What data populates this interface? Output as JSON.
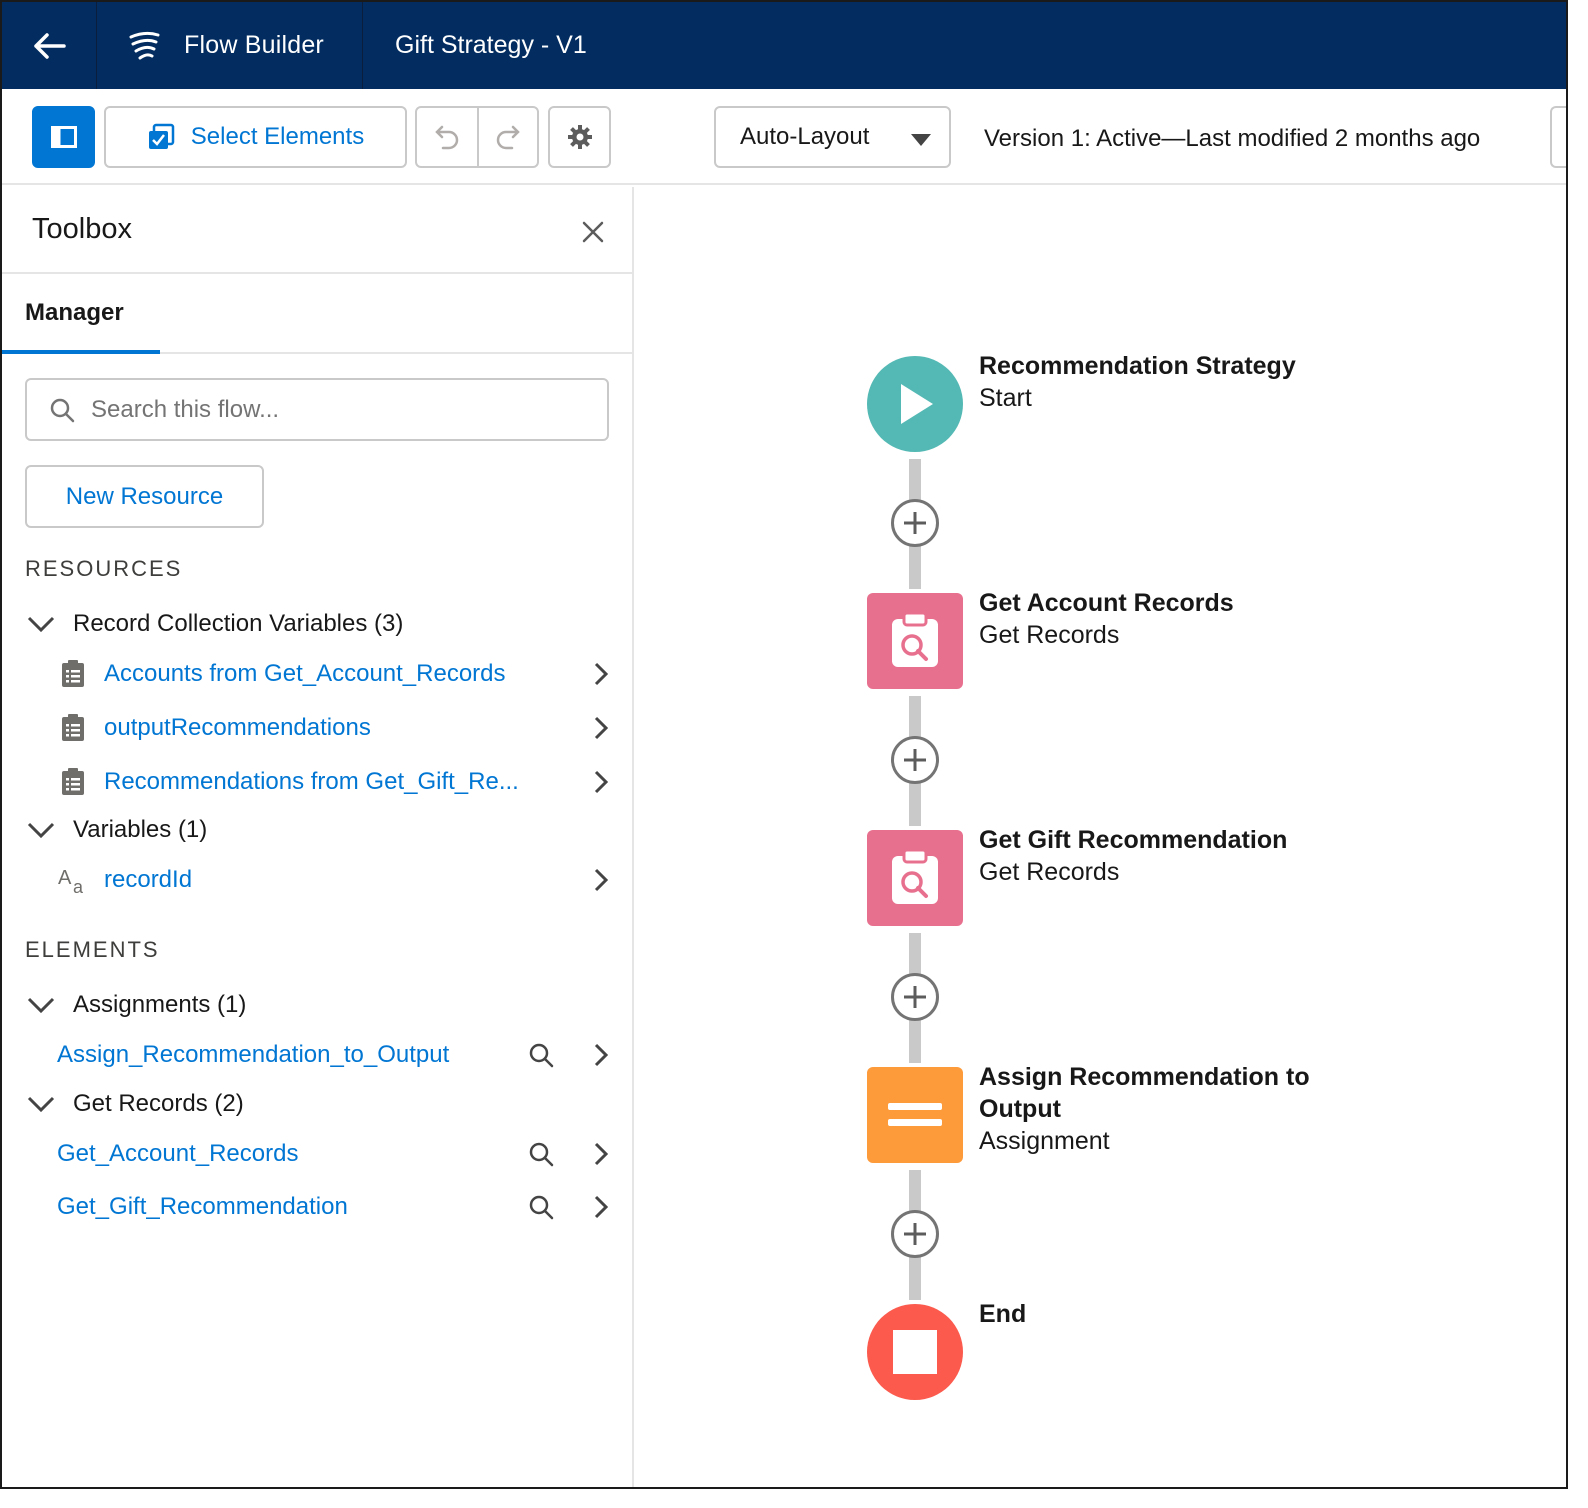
{
  "header": {
    "app_title": "Flow Builder",
    "flow_title": "Gift Strategy - V1"
  },
  "toolbar": {
    "select_elements_label": "Select Elements",
    "layout_value": "Auto-Layout",
    "version_status": "Version 1: Active—Last modified 2 months ago"
  },
  "toolbox": {
    "title": "Toolbox",
    "tab_manager": "Manager",
    "search_placeholder": "Search this flow...",
    "new_resource_label": "New Resource",
    "resources_heading": "RESOURCES",
    "elements_heading": "ELEMENTS",
    "resource_groups": [
      {
        "label": "Record Collection Variables (3)",
        "items": [
          "Accounts from Get_Account_Records",
          "outputRecommendations",
          "Recommendations from Get_Gift_Re..."
        ]
      },
      {
        "label": "Variables (1)",
        "items": [
          "recordId"
        ]
      }
    ],
    "element_groups": [
      {
        "label": "Assignments (1)",
        "items": [
          "Assign_Recommendation_to_Output"
        ]
      },
      {
        "label": "Get Records (2)",
        "items": [
          "Get_Account_Records",
          "Get_Gift_Recommendation"
        ]
      }
    ]
  },
  "canvas": {
    "nodes": [
      {
        "name": "Recommendation Strategy",
        "type": "Start",
        "icon": "play-icon",
        "color": "#54b9b4"
      },
      {
        "name": "Get Account Records",
        "type": "Get Records",
        "icon": "get-records-icon",
        "color": "#e8708f"
      },
      {
        "name": "Get Gift Recommendation",
        "type": "Get Records",
        "icon": "get-records-icon",
        "color": "#e8708f"
      },
      {
        "name": "Assign Recommendation to Output",
        "type": "Assignment",
        "icon": "assignment-icon",
        "color": "#fd9b3b"
      },
      {
        "name": "End",
        "type": "",
        "icon": "stop-icon",
        "color": "#fb5a4d"
      }
    ]
  },
  "colors": {
    "header_bg": "#032d60",
    "brand_blue": "#0176d3"
  }
}
